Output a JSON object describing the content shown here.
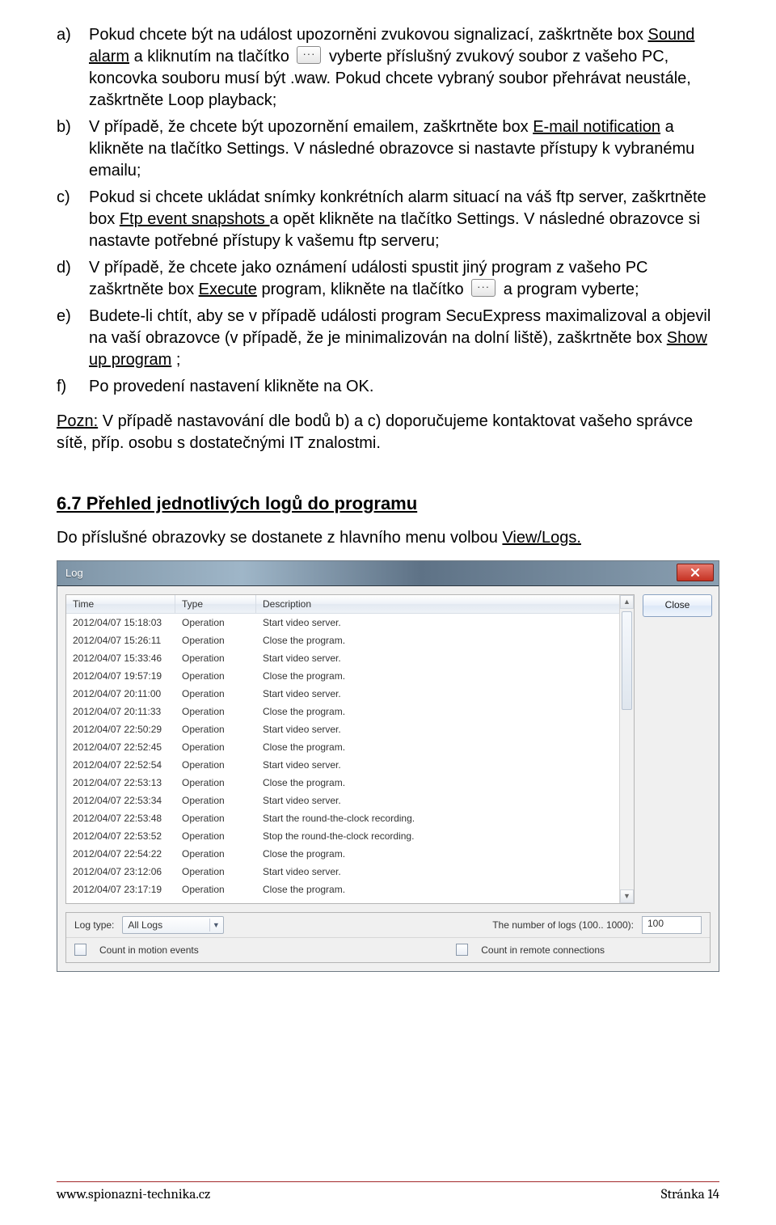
{
  "doc": {
    "items": {
      "a_pre": "Pokud chcete být na událost upozorněni zvukovou signalizací, zaškrtněte box ",
      "a_underline": "Sound alarm",
      "a_mid": " a kliknutím na tlačítko ",
      "browse_glyph": "···",
      "a_tail": " vyberte příslušný zvukový soubor z vašeho PC, koncovka souboru musí být .waw. Pokud chcete vybraný soubor přehrávat neustále, zaškrtněte Loop playback;",
      "b_pre": "V případě, že chcete být upozornění emailem, zaškrtněte box ",
      "b_underline": "E-mail notification",
      "b_tail": " a klikněte na tlačítko Settings. V následné obrazovce si nastavte přístupy k vybranému emailu;",
      "c_pre": "Pokud si chcete ukládat snímky konkrétních alarm situací na váš ftp server, zaškrtněte box ",
      "c_underline": "Ftp event snapshots ",
      "c_tail": "a opět klikněte na tlačítko Settings. V následné obrazovce si nastavte potřebné přístupy k vašemu ftp serveru;",
      "d_pre": "V případě, že chcete jako oznámení události spustit jiný program z vašeho PC zaškrtněte box ",
      "d_underline": "Execute",
      "d_mid": " program, klikněte na tlačítko ",
      "d_tail": " a program vyberte;",
      "e_pre": "Budete-li chtít, aby se v případě události program SecuExpress maximalizoval a objevil na vaší obrazovce (v případě, že je minimalizován na dolní liště), zaškrtněte box ",
      "e_underline": "Show up program",
      "e_tail": ";",
      "f_text": "Po provedení nastavení klikněte na OK."
    },
    "note_u": "Pozn:",
    "note_rest": " V případě nastavování dle bodů b) a c) doporučujeme kontaktovat vašeho správce sítě, příp. osobu s dostatečnými IT znalostmi.",
    "section_heading": "6.7 Přehled jednotlivých logů do programu",
    "prelog_pre": "Do příslušné obrazovky se dostanete z hlavního menu volbou ",
    "prelog_u": "View/Logs.",
    "markers": {
      "a": "a)",
      "b": "b)",
      "c": "c)",
      "d": "d)",
      "e": "e)",
      "f": "f)"
    }
  },
  "log": {
    "title": "Log",
    "close_btn": "Close",
    "cols": {
      "time": "Time",
      "type": "Type",
      "desc": "Description"
    },
    "rows": [
      {
        "time": "2012/04/07 15:18:03",
        "type": "Operation",
        "desc": "Start video server."
      },
      {
        "time": "2012/04/07 15:26:11",
        "type": "Operation",
        "desc": "Close the program."
      },
      {
        "time": "2012/04/07 15:33:46",
        "type": "Operation",
        "desc": "Start video server."
      },
      {
        "time": "2012/04/07 19:57:19",
        "type": "Operation",
        "desc": "Close the program."
      },
      {
        "time": "2012/04/07 20:11:00",
        "type": "Operation",
        "desc": "Start video server."
      },
      {
        "time": "2012/04/07 20:11:33",
        "type": "Operation",
        "desc": "Close the program."
      },
      {
        "time": "2012/04/07 22:50:29",
        "type": "Operation",
        "desc": "Start video server."
      },
      {
        "time": "2012/04/07 22:52:45",
        "type": "Operation",
        "desc": "Close the program."
      },
      {
        "time": "2012/04/07 22:52:54",
        "type": "Operation",
        "desc": "Start video server."
      },
      {
        "time": "2012/04/07 22:53:13",
        "type": "Operation",
        "desc": "Close the program."
      },
      {
        "time": "2012/04/07 22:53:34",
        "type": "Operation",
        "desc": "Start video server."
      },
      {
        "time": "2012/04/07 22:53:48",
        "type": "Operation",
        "desc": "Start the round-the-clock recording."
      },
      {
        "time": "2012/04/07 22:53:52",
        "type": "Operation",
        "desc": "Stop the round-the-clock recording."
      },
      {
        "time": "2012/04/07 22:54:22",
        "type": "Operation",
        "desc": "Close the program."
      },
      {
        "time": "2012/04/07 23:12:06",
        "type": "Operation",
        "desc": "Start video server."
      },
      {
        "time": "2012/04/07 23:17:19",
        "type": "Operation",
        "desc": "Close the program."
      }
    ],
    "footer": {
      "log_type_label": "Log type:",
      "log_type_value": "All Logs",
      "num_label": "The number of logs (100.. 1000):",
      "num_value": "100",
      "count_motion": "Count in motion events",
      "count_remote": "Count in remote connections"
    }
  },
  "page_footer": {
    "left": "www.spionazni-technika.cz",
    "right": "Stránka 14"
  }
}
